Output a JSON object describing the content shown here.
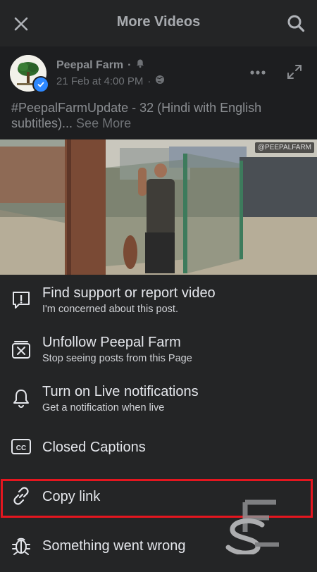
{
  "header": {
    "title": "More Videos",
    "close_icon": "close-icon",
    "search_icon": "search-icon"
  },
  "post": {
    "author": "Peepal Farm",
    "date": "21 Feb at 4:00 PM",
    "caption": "#PeepalFarmUpdate - 32 (Hindi with English subtitles)...",
    "see_more": "See More",
    "video_watermark": "@PEEPALFARM"
  },
  "menu": [
    {
      "label": "Find support or report video",
      "sub": "I'm concerned about this post.",
      "icon": "report-icon"
    },
    {
      "label": "Unfollow Peepal Farm",
      "sub": "Stop seeing posts from this Page",
      "icon": "unfollow-icon"
    },
    {
      "label": "Turn on Live notifications",
      "sub": "Get a notification when live",
      "icon": "bell-icon"
    },
    {
      "label": "Closed Captions",
      "icon": "cc-icon"
    },
    {
      "label": "Copy link",
      "icon": "link-icon"
    },
    {
      "label": "Something went wrong",
      "icon": "bug-icon"
    }
  ],
  "colors": {
    "background": "#18191a",
    "sheet": "#242526",
    "highlight": "#e5161f",
    "verified": "#2d88ff"
  }
}
